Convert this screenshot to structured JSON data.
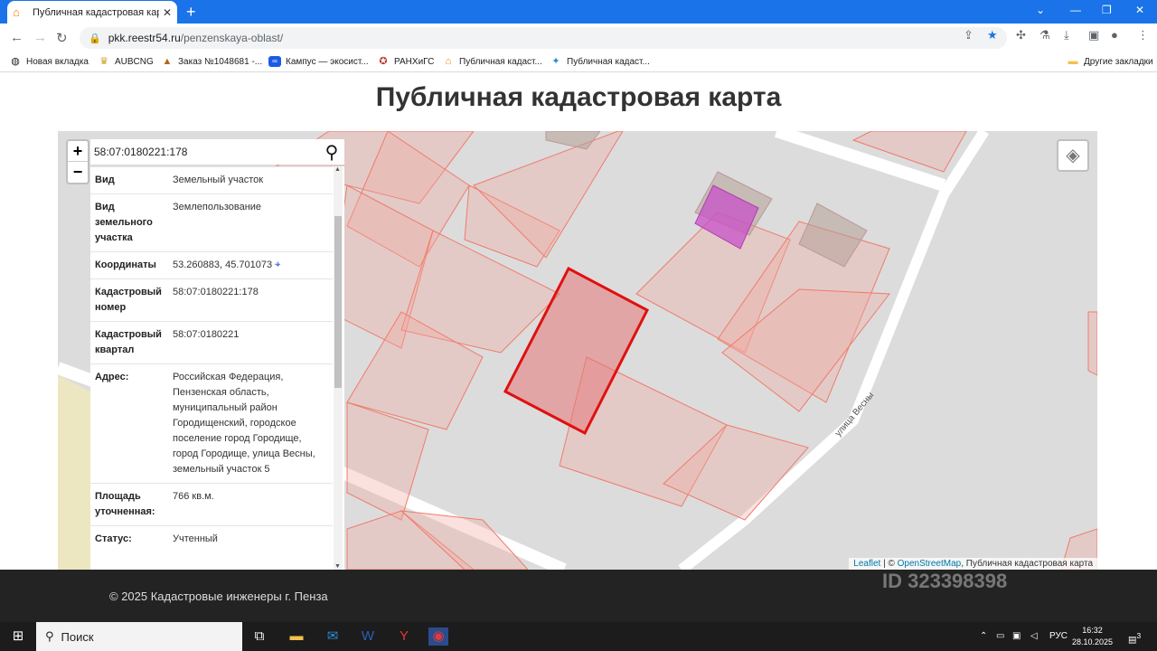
{
  "browser": {
    "tab_title": "Публичная кадастровая карта П",
    "tab_close": "✕",
    "new_tab": "+",
    "url_host": "pkk.reestr54.ru",
    "url_path": "/penzenskaya-oblast/",
    "bookmarks": [
      {
        "label": "Новая вкладка",
        "icon": "globe-icon"
      },
      {
        "label": "AUBCNG",
        "icon": "emblem-icon"
      },
      {
        "label": "Заказ №1048681 -...",
        "icon": "order-icon"
      },
      {
        "label": "Кампус — экосист...",
        "icon": "campus-icon"
      },
      {
        "label": "РАНХиГС",
        "icon": "ranepa-icon"
      },
      {
        "label": "Публичная кадаст...",
        "icon": "cadastre-icon"
      },
      {
        "label": "Публичная кадаст...",
        "icon": "cadastre-icon"
      }
    ],
    "other_bookmarks": "Другие закладки"
  },
  "page": {
    "title": "Публичная кадастровая карта"
  },
  "map": {
    "zoom_in": "+",
    "zoom_out": "−",
    "search_value": "58:07:0180221:178",
    "street_label": "улица Весны",
    "attribution": {
      "leaflet": "Leaflet",
      "sep": " | © ",
      "osm": "OpenStreetMap",
      "rest": ", Публичная кадастровая карта"
    }
  },
  "info": {
    "rows": [
      {
        "key": "Вид",
        "value": "Земельный участок"
      },
      {
        "key": "Вид земельного участка",
        "value": "Землепользование"
      },
      {
        "key": "Координаты",
        "value": "53.260883, 45.701073"
      },
      {
        "key": "Кадастровый номер",
        "value": "58:07:0180221:178"
      },
      {
        "key": "Кадастровый квартал",
        "value": "58:07:0180221"
      },
      {
        "key": "Адрес:",
        "value": "Российская Федерация, Пензенская область, муниципальный район Городищенский, городское поселение город Городище, город Городище, улица Весны, земельный участок 5"
      },
      {
        "key": "Площадь уточненная:",
        "value": "766 кв.м."
      },
      {
        "key": "Статус:",
        "value": "Учтенный"
      }
    ]
  },
  "footer": {
    "copyright": "© 2025 Кадастровые инженеры г. Пенза"
  },
  "watermark": "ID 323398398",
  "taskbar": {
    "search": "Поиск",
    "lang": "РУС",
    "time": "16:32",
    "date": "28.10.2025",
    "notif_count": "3"
  }
}
